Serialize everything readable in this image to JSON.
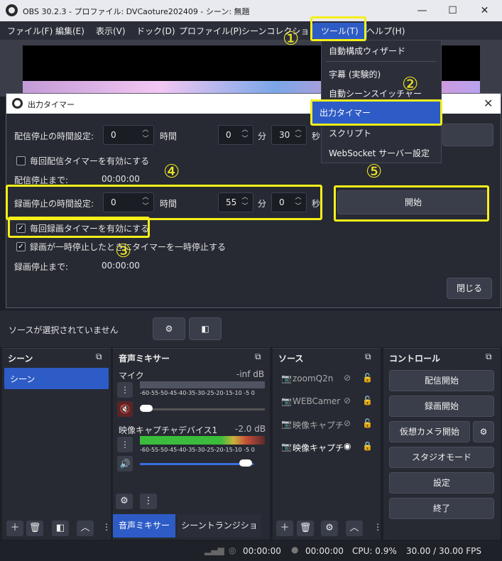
{
  "window": {
    "title": "OBS 30.2.3 - プロファイル: DVCaoture202409 - シーン: 無題"
  },
  "menubar": {
    "items": [
      "ファイル(F)",
      "編集(E)",
      "表示(V)",
      "ドック(D)",
      "プロファイル(P)",
      "シーンコレクション(S)",
      "ツール(T)",
      "ヘルプ(H)"
    ]
  },
  "tools_menu": {
    "items": [
      "自動構成ウィザード",
      "字幕 (実験的)",
      "自動シーンスイッチャー",
      "出力タイマー",
      "スクリプト",
      "WebSocket サーバー設定"
    ],
    "selected": "出力タイマー"
  },
  "dialog": {
    "title": "出力タイマー",
    "stream": {
      "label": "配信停止の時間設定:",
      "hours": "0",
      "hours_unit": "時間",
      "minutes": "0",
      "minutes_unit": "分",
      "seconds": "30",
      "seconds_unit": "秒",
      "checkbox_label": "毎回配信タイマーを有効にする",
      "checkbox_checked": false,
      "remaining_label": "配信停止まで:",
      "remaining": "00:00:00"
    },
    "record": {
      "label": "録画停止の時間設定:",
      "hours": "0",
      "hours_unit": "時間",
      "minutes": "55",
      "minutes_unit": "分",
      "seconds": "0",
      "seconds_unit": "秒",
      "checkbox_label": "毎回録画タイマーを有効にする",
      "checkbox_checked": true,
      "pause_label": "録画が一時停止したときにタイマーを一時停止する",
      "pause_checked": true,
      "remaining_label": "録画停止まで:",
      "remaining": "00:00:00",
      "start_label": "開始"
    },
    "close_label": "閉じる"
  },
  "annotations": {
    "n1": "①",
    "n2": "②",
    "n3": "③",
    "n4": "④",
    "n5": "⑤"
  },
  "source_bar": {
    "text": "ソースが選択されていません"
  },
  "scenes": {
    "header": "シーン",
    "items": [
      "シーン"
    ]
  },
  "mixer": {
    "header": "音声ミキサー",
    "tracks": [
      {
        "name": "マイク",
        "level": "-inf dB",
        "muted": true
      },
      {
        "name": "映像キャプチャデバイス1",
        "level": "-2.0 dB",
        "muted": false,
        "meter_fill": 0.85
      }
    ],
    "scale": "-60-55-50-45-40-35-30-25-20-15-10 -5 0"
  },
  "sources": {
    "header": "ソース",
    "items": [
      {
        "name": "zoomQ2n",
        "visible": false
      },
      {
        "name": "WEBCamer",
        "visible": false
      },
      {
        "name": "映像キャプチ",
        "visible": false
      },
      {
        "name": "映像キャプチ",
        "visible": true
      }
    ]
  },
  "controls": {
    "header": "コントロール",
    "buttons": [
      "配信開始",
      "録画開始",
      "仮想カメラ開始",
      "スタジオモード",
      "設定",
      "終了"
    ]
  },
  "tabs": {
    "mixer": "音声ミキサー",
    "transition": "シーントランジション"
  },
  "status": {
    "stream_time": "00:00:00",
    "rec_time": "00:00:00",
    "cpu": "CPU: 0.9%",
    "fps": "30.00 / 30.00 FPS"
  },
  "colors": {
    "accent": "#2e5cc6",
    "highlight": "#f5ef1a"
  }
}
